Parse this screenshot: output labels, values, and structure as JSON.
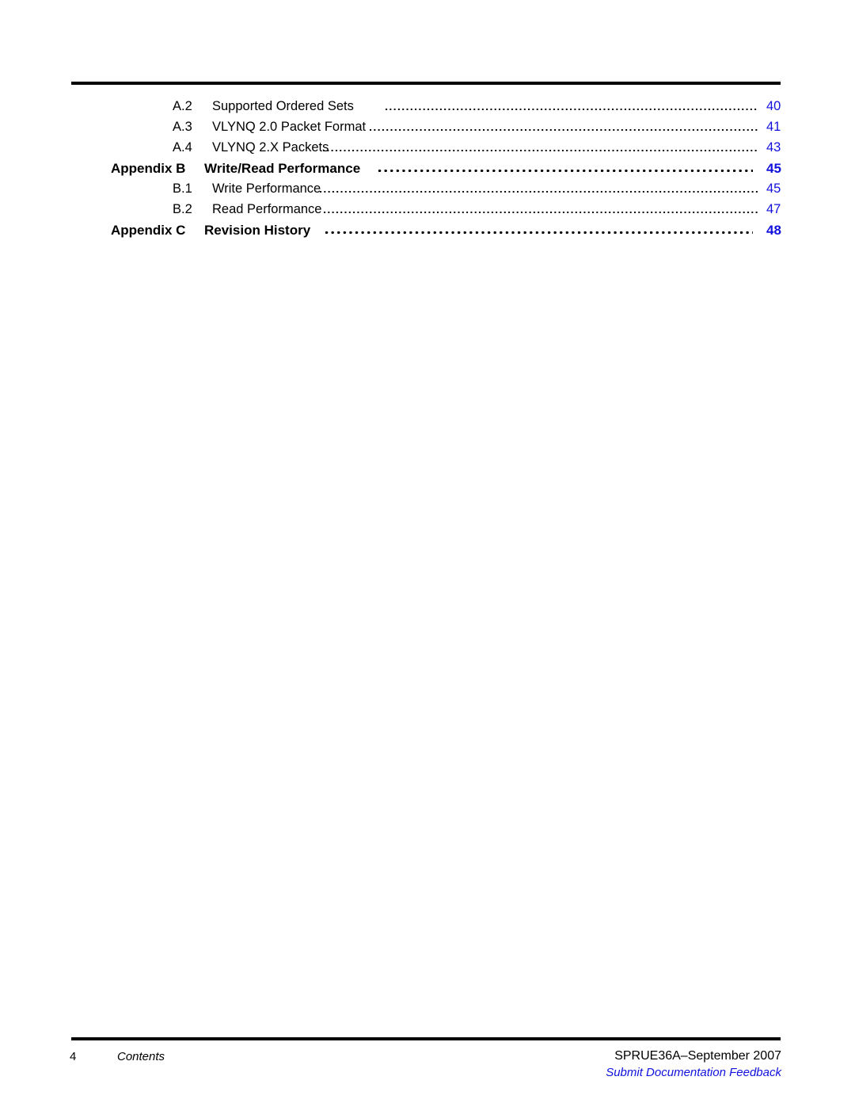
{
  "document": {
    "section_name": "Contents",
    "page_number": "4",
    "doc_id_line": "SPRUE36A–September 2007",
    "feedback_link": "Submit Documentation Feedback"
  },
  "colors": {
    "link_blue": "#1111dd",
    "text_black": "#000000",
    "rule_black": "#000000"
  },
  "toc": {
    "entries": [
      {
        "level": "sub",
        "number": "A.2",
        "title": "Supported Ordered Sets",
        "page": "40"
      },
      {
        "level": "sub",
        "number": "A.3",
        "title": "VLYNQ 2.0 Packet Format",
        "page": "41"
      },
      {
        "level": "sub",
        "number": "A.4",
        "title": "VLYNQ 2.X Packets",
        "page": "43"
      },
      {
        "level": "appendix",
        "number": "Appendix B",
        "title": "Write/Read Performance",
        "page": "45"
      },
      {
        "level": "sub",
        "number": "B.1",
        "title": "Write Performance",
        "page": "45"
      },
      {
        "level": "sub",
        "number": "B.2",
        "title": "Read Performance",
        "page": "47"
      },
      {
        "level": "appendix",
        "number": "Appendix C",
        "title": "Revision History",
        "page": "48"
      }
    ]
  }
}
